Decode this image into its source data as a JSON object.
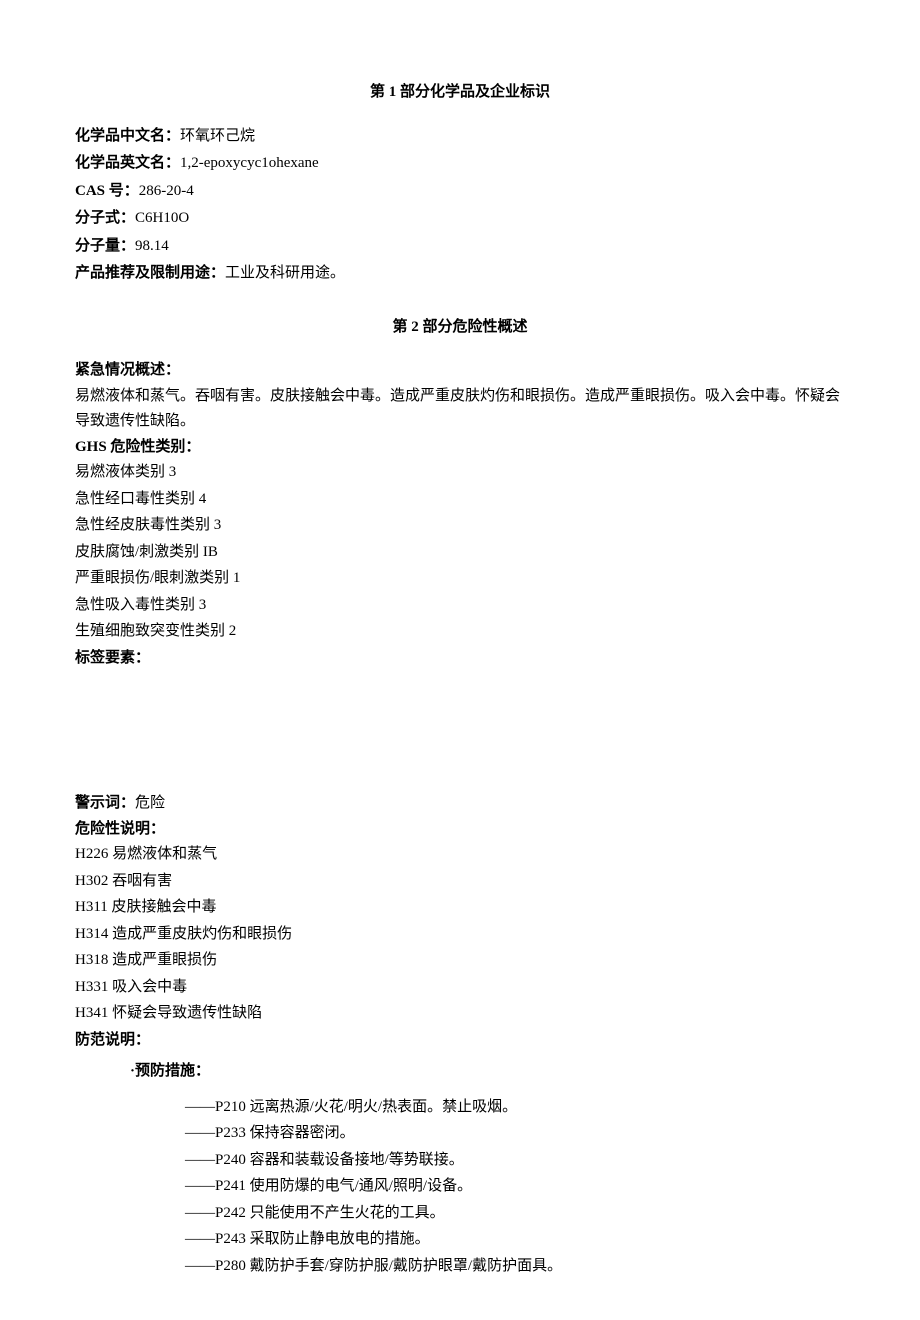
{
  "section1": {
    "heading_prefix": "第",
    "heading_num": " 1 ",
    "heading_suffix": "部分化学品及企业标识",
    "name_cn_label": "化学品中文名：",
    "name_cn_value": "环氧环己烷",
    "name_en_label": "化学品英文名：",
    "name_en_value": "1,2-epoxycyc1ohexane",
    "cas_label": "CAS",
    "cas_label2": " 号：",
    "cas_value": "286-20-4",
    "formula_label": "分子式：",
    "formula_value": "C6H10O",
    "mw_label": "分子量：",
    "mw_value": "98.14",
    "use_label": "产品推荐及限制用途：",
    "use_value": "工业及科研用途。"
  },
  "section2": {
    "heading_prefix": "第",
    "heading_num": " 2 ",
    "heading_suffix": "部分危险性概述",
    "emergency_label": "紧急情况概述：",
    "emergency_text": "易燃液体和蒸气。吞咽有害。皮肤接触会中毒。造成严重皮肤灼伤和眼损伤。造成严重眼损伤。吸入会中毒。怀疑会导致遗传性缺陷。",
    "ghs_label": "GHS 危险性类别：",
    "ghs_items": [
      "易燃液体类别 3",
      "急性经口毒性类别 4",
      "急性经皮肤毒性类别 3",
      "皮肤腐蚀/刺激类别 IB",
      "严重眼损伤/眼刺激类别 1",
      "急性吸入毒性类别 3",
      "生殖细胞致突变性类别 2"
    ],
    "label_elements": "标签要素：",
    "signal_label": "警示词：",
    "signal_value": "危险",
    "hazard_stmt_label": "危险性说明：",
    "hazard_items": [
      "H226 易燃液体和蒸气",
      "H302 吞咽有害",
      "H311 皮肤接触会中毒",
      "H314 造成严重皮肤灼伤和眼损伤",
      "H318 造成严重眼损伤",
      "H331 吸入会中毒",
      "H341 怀疑会导致遗传性缺陷"
    ],
    "precaution_label": "防范说明：",
    "prevention_bullet": "·",
    "prevention_header": "预防措施：",
    "prevention_items": [
      "——P210 远离热源/火花/明火/热表面。禁止吸烟。",
      "——P233 保持容器密闭。",
      "——P240 容器和装载设备接地/等势联接。",
      "——P241 使用防爆的电气/通风/照明/设备。",
      "——P242 只能使用不产生火花的工具。",
      "——P243 采取防止静电放电的措施。",
      "——P280 戴防护手套/穿防护服/戴防护眼罩/戴防护面具。"
    ]
  }
}
